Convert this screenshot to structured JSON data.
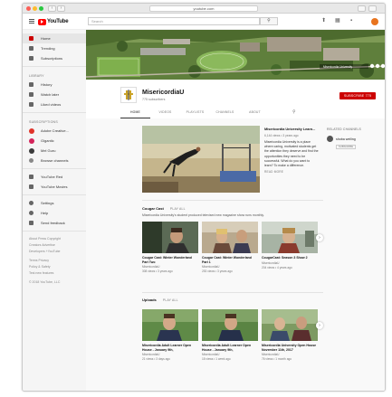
{
  "browser": {
    "url": "youtube.com"
  },
  "masthead": {
    "logo_text": "YouTube",
    "search_placeholder": "Search"
  },
  "sidebar": {
    "main_items": [
      {
        "label": "Home",
        "icon": "home-icon"
      },
      {
        "label": "Trending",
        "icon": "trending-icon"
      },
      {
        "label": "Subscriptions",
        "icon": "subscriptions-icon"
      }
    ],
    "library_heading": "LIBRARY",
    "library_items": [
      {
        "label": "History",
        "icon": "history-icon"
      },
      {
        "label": "Watch later",
        "icon": "watch-later-icon"
      },
      {
        "label": "Liked videos",
        "icon": "liked-icon"
      }
    ],
    "subscriptions_heading": "SUBSCRIPTIONS",
    "subscriptions": [
      {
        "label": "Adobe Creative...",
        "color": "#e0342a"
      },
      {
        "label": "Gigantic",
        "color": "#d4245a"
      },
      {
        "label": "Mel Guru",
        "color": "#3a3a3a"
      }
    ],
    "browse_channels": "Browse channels",
    "more_items": [
      {
        "label": "YouTube Red",
        "icon": "youtube-red-icon"
      },
      {
        "label": "YouTube Movies",
        "icon": "movies-icon"
      }
    ],
    "settings_items": [
      {
        "label": "Settings",
        "icon": "gear-icon"
      },
      {
        "label": "Help",
        "icon": "help-icon"
      },
      {
        "label": "Send feedback",
        "icon": "feedback-icon"
      }
    ],
    "footer_lines": [
      "About  Press  Copyright",
      "Creators  Advertise",
      "Developers  +YouTube",
      "",
      "Terms  Privacy",
      "Policy & Safety",
      "Test new features",
      "",
      "© 2018 YouTube, LLC"
    ]
  },
  "channel": {
    "name": "MisericordiaU",
    "subscribers": "775 subscribers",
    "subscribe_label": "SUBSCRIBE  775",
    "tabs": [
      "HOME",
      "VIDEOS",
      "PLAYLISTS",
      "CHANNELS",
      "ABOUT"
    ],
    "active_tab": "HOME"
  },
  "featured": {
    "title": "Misericordia University Learn...",
    "views": "6,144 views • 3 years ago",
    "description": "Misericordia University is a place where caring, motivated students get the attention they deserve and find the opportunities they need to be successful. What do you want to learn? To make a difference.",
    "read_more": "READ MORE"
  },
  "related_channels": {
    "heading": "RELATED CHANNELS",
    "items": [
      {
        "name": "shoba weiling",
        "subscribe": "SUBSCRIBE"
      }
    ]
  },
  "shelves": [
    {
      "title": "Cougar Cast",
      "play_all": "PLAY ALL",
      "description": "Misericordia University's student produced televised new magazine show runs monthly.",
      "videos": [
        {
          "title": "Cougar Cast: Winter Wonderland Part Two",
          "channel": "MisericordiaU",
          "meta": "308 views • 3 years ago"
        },
        {
          "title": "Cougar Cast: Winter Wonderland Part 1",
          "channel": "MisericordiaU",
          "meta": "253 views • 3 years ago"
        },
        {
          "title": "CougarCast: Season 3 Show 2",
          "channel": "MisericordiaU",
          "meta": "204 views • 4 years ago"
        }
      ]
    },
    {
      "title": "Uploads",
      "play_all": "PLAY ALL",
      "description": "",
      "videos": [
        {
          "title": "Misericordia Adult Learner Open House - January 9th,",
          "channel": "MisericordiaU",
          "meta": "21 views • 3 days ago"
        },
        {
          "title": "Misericordia Adult Learner Open House - January 9th,",
          "channel": "MisericordiaU",
          "meta": "18 views • 1 week ago"
        },
        {
          "title": "Misericordia University Open House November 11th, 2017",
          "channel": "MisericordiaU",
          "meta": "76 views • 1 month ago"
        }
      ]
    }
  ]
}
